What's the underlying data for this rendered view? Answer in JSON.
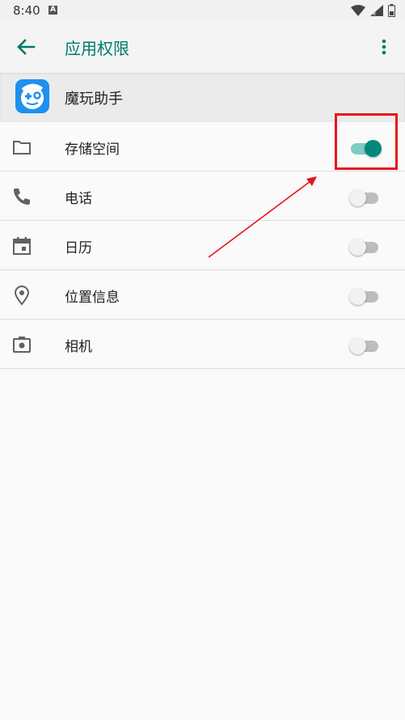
{
  "status_bar": {
    "time": "8:40",
    "notification_badge": "A",
    "icons": [
      "wifi-icon",
      "signal-icon",
      "battery-icon"
    ]
  },
  "app_bar": {
    "title": "应用权限",
    "back_icon": "arrow-left-icon",
    "menu_icon": "more-vert-icon"
  },
  "app": {
    "name": "魔玩助手"
  },
  "permissions": [
    {
      "label": "存储空间",
      "icon": "folder-icon",
      "enabled": true
    },
    {
      "label": "电话",
      "icon": "phone-icon",
      "enabled": false
    },
    {
      "label": "日历",
      "icon": "calendar-icon",
      "enabled": false
    },
    {
      "label": "位置信息",
      "icon": "location-icon",
      "enabled": false
    },
    {
      "label": "相机",
      "icon": "camera-icon",
      "enabled": false
    }
  ],
  "colors": {
    "accent": "#00796b",
    "toggle_on": "#00897b",
    "annotation": "#e8141b"
  }
}
